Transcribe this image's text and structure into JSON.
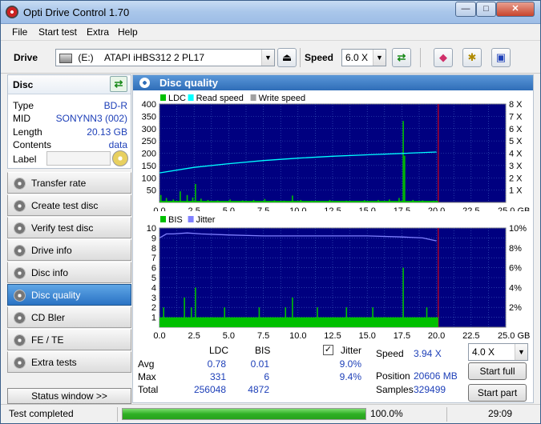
{
  "window": {
    "title": "Opti Drive Control 1.70",
    "minimize": "—",
    "maximize": "□",
    "close": "✕"
  },
  "menu": [
    "File",
    "Start test",
    "Extra",
    "Help"
  ],
  "toolbar": {
    "drive_label": "Drive",
    "drive_letter": "(E:)",
    "drive_value": "ATAPI iHBS312  2 PL17",
    "speed_label": "Speed",
    "speed_value": "6.0 X",
    "icons": [
      "eject-icon",
      "refresh-icon",
      "eraser-icon",
      "drive-settings-icon",
      "save-icon"
    ]
  },
  "disc": {
    "title": "Disc",
    "rows": [
      {
        "label": "Type",
        "value": "BD-R"
      },
      {
        "label": "MID",
        "value": "SONYNN3 (002)"
      },
      {
        "label": "Length",
        "value": "20.13 GB"
      },
      {
        "label": "Contents",
        "value": "data"
      }
    ],
    "label_label": "Label",
    "label_value": ""
  },
  "nav": [
    {
      "label": "Transfer rate",
      "active": false
    },
    {
      "label": "Create test disc",
      "active": false
    },
    {
      "label": "Verify test disc",
      "active": false
    },
    {
      "label": "Drive info",
      "active": false
    },
    {
      "label": "Disc info",
      "active": false
    },
    {
      "label": "Disc quality",
      "active": true
    },
    {
      "label": "CD Bler",
      "active": false
    },
    {
      "label": "FE / TE",
      "active": false
    },
    {
      "label": "Extra tests",
      "active": false
    }
  ],
  "status_window_label": "Status window >>",
  "panel_title": "Disc quality",
  "colors": {
    "ldc": "#00c000",
    "read_speed": "#00ffff",
    "write_speed": "#a0a0a0",
    "bis": "#00c000",
    "jitter": "#8080ff",
    "plot_bg": "#000080",
    "grid": "#4060c0",
    "max_line": "#ff0000",
    "accent": "#1d3fb8"
  },
  "chart_data": [
    {
      "type": "bar",
      "legend": [
        "LDC",
        "Read speed",
        "Write speed"
      ],
      "xlabel": "GB",
      "x_ticks": [
        "0.0",
        "2.5",
        "5.0",
        "7.5",
        "10.0",
        "12.5",
        "15.0",
        "17.5",
        "20.0",
        "22.5",
        "25.0 GB"
      ],
      "xlim": [
        0,
        25
      ],
      "y_ticks": [
        "400",
        "350",
        "300",
        "250",
        "200",
        "150",
        "100",
        "50"
      ],
      "ylim": [
        0,
        400
      ],
      "y2_ticks": [
        "8 X",
        "7 X",
        "6 X",
        "5 X",
        "4 X",
        "3 X",
        "2 X",
        "1 X"
      ],
      "y2lim": [
        0,
        8
      ],
      "disc_end": 20.13,
      "ldc_spikes": [
        [
          0.1,
          30
        ],
        [
          0.5,
          18
        ],
        [
          1.0,
          12
        ],
        [
          1.5,
          45
        ],
        [
          2.0,
          30
        ],
        [
          2.4,
          20
        ],
        [
          2.6,
          75
        ],
        [
          3.0,
          15
        ],
        [
          3.5,
          10
        ],
        [
          4.2,
          8
        ],
        [
          5.1,
          12
        ],
        [
          6.0,
          8
        ],
        [
          6.8,
          10
        ],
        [
          7.6,
          14
        ],
        [
          8.3,
          8
        ],
        [
          9.0,
          7
        ],
        [
          9.6,
          28
        ],
        [
          10.2,
          10
        ],
        [
          11.0,
          6
        ],
        [
          12.3,
          10
        ],
        [
          13.5,
          7
        ],
        [
          14.8,
          9
        ],
        [
          15.8,
          10
        ],
        [
          16.6,
          12
        ],
        [
          17.3,
          18
        ],
        [
          17.6,
          331
        ],
        [
          17.7,
          190
        ],
        [
          18.3,
          10
        ],
        [
          19.0,
          8
        ],
        [
          19.8,
          7
        ]
      ],
      "ldc_baseline": 6,
      "read_speed": [
        [
          0,
          2.4
        ],
        [
          2.5,
          2.85
        ],
        [
          5,
          3.15
        ],
        [
          7.5,
          3.4
        ],
        [
          10,
          3.6
        ],
        [
          12.5,
          3.75
        ],
        [
          15,
          3.87
        ],
        [
          17.5,
          3.98
        ],
        [
          20,
          4.1
        ]
      ]
    },
    {
      "type": "bar",
      "legend": [
        "BIS",
        "Jitter"
      ],
      "xlabel": "GB",
      "x_ticks": [
        "0.0",
        "2.5",
        "5.0",
        "7.5",
        "10.0",
        "12.5",
        "15.0",
        "17.5",
        "20.0",
        "22.5",
        "25.0 GB"
      ],
      "xlim": [
        0,
        25
      ],
      "y_ticks": [
        "10",
        "9",
        "8",
        "7",
        "6",
        "5",
        "4",
        "3",
        "2",
        "1"
      ],
      "ylim": [
        0,
        10
      ],
      "y2_ticks": [
        "10%",
        "8%",
        "6%",
        "4%",
        "2%"
      ],
      "y2lim": [
        0,
        10
      ],
      "disc_end": 20.13,
      "bis_spikes": [
        [
          0.3,
          2
        ],
        [
          1.8,
          3
        ],
        [
          2.3,
          2
        ],
        [
          2.6,
          4
        ],
        [
          3.4,
          1
        ],
        [
          4.7,
          2
        ],
        [
          6.1,
          1
        ],
        [
          7.2,
          2
        ],
        [
          8.0,
          1
        ],
        [
          9.1,
          2
        ],
        [
          9.6,
          3
        ],
        [
          10.7,
          1
        ],
        [
          11.4,
          2
        ],
        [
          12.6,
          1
        ],
        [
          13.5,
          2
        ],
        [
          14.5,
          1
        ],
        [
          15.4,
          2
        ],
        [
          16.3,
          1
        ],
        [
          17.6,
          6
        ],
        [
          18.4,
          1
        ],
        [
          19.3,
          2
        ]
      ],
      "bis_baseline": 1,
      "jitter": [
        [
          0,
          9.0
        ],
        [
          0.5,
          9.4
        ],
        [
          1.0,
          9.4
        ],
        [
          2.0,
          9.5
        ],
        [
          3.0,
          9.4
        ],
        [
          5.0,
          9.3
        ],
        [
          7.5,
          9.2
        ],
        [
          10.0,
          9.2
        ],
        [
          12.5,
          9.2
        ],
        [
          15.0,
          9.2
        ],
        [
          17.5,
          9.1
        ],
        [
          19.0,
          9.0
        ],
        [
          20.0,
          8.7
        ]
      ]
    }
  ],
  "stats": {
    "headers": [
      "LDC",
      "BIS"
    ],
    "rows": [
      {
        "label": "Avg",
        "ldc": "0.78",
        "bis": "0.01",
        "jitter": "9.0%"
      },
      {
        "label": "Max",
        "ldc": "331",
        "bis": "6",
        "jitter": "9.4%"
      },
      {
        "label": "Total",
        "ldc": "256048",
        "bis": "4872",
        "jitter": ""
      }
    ],
    "jitter_label": "Jitter",
    "jitter_checked": true,
    "speed_label": "Speed",
    "speed_value": "3.94 X",
    "speed_select": "4.0 X",
    "position_label": "Position",
    "position_value": "20606 MB",
    "samples_label": "Samples",
    "samples_value": "329499",
    "start_full": "Start full",
    "start_part": "Start part"
  },
  "statusbar": {
    "text": "Test completed",
    "progress_percent": 100,
    "progress_text": "100.0%",
    "time": "29:09"
  }
}
